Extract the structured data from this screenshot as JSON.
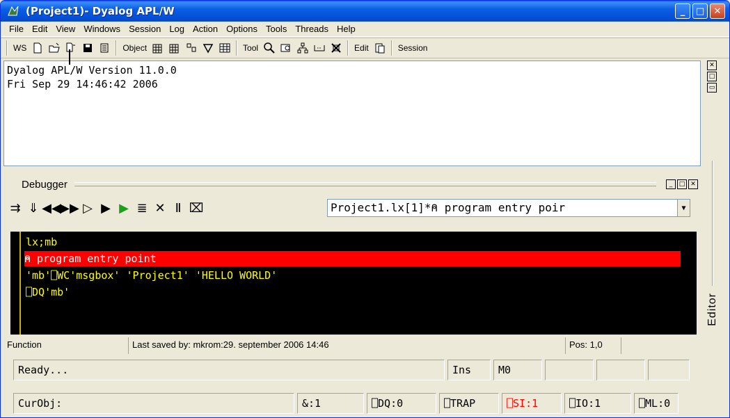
{
  "window": {
    "title": "(Project1)- Dyalog APL/W"
  },
  "menu": [
    "File",
    "Edit",
    "View",
    "Windows",
    "Session",
    "Log",
    "Action",
    "Options",
    "Tools",
    "Threads",
    "Help"
  ],
  "toolbar": {
    "ws_label": "WS",
    "object_label": "Object",
    "tool_label": "Tool",
    "edit_label": "Edit",
    "session_label": "Session"
  },
  "session": {
    "lines": [
      "Dyalog APL/W Version 11.0.0",
      "Fri Sep 29 14:46:42 2006"
    ]
  },
  "debugger": {
    "title": "Debugger",
    "selected_function": "Project1.lx[1]*⍝ program entry poir",
    "code": [
      "lx;mb",
      "⍝ program entry point",
      "'mb'⎕WC'msgbox' 'Project1' 'HELLO WORLD'",
      "⎕DQ'mb'"
    ],
    "status": {
      "type": "Function",
      "saved": "Last saved by: mkrom:29. september 2006 14:46",
      "pos": "Pos: 1,0"
    }
  },
  "editor_tab": "Editor",
  "status1": {
    "message": "Ready...",
    "ins": "Ins",
    "mode": "M0"
  },
  "status2": {
    "curobj": "CurObj:",
    "amp": "&:1",
    "dq": "⎕DQ:0",
    "trap": "⎕TRAP",
    "si": "⎕SI:1",
    "io": "⎕IO:1",
    "ml": "⎕ML:0"
  },
  "colors": {
    "active_line": "#ff0000",
    "code_fg": "#ffff00",
    "si_color": "#ff0000"
  }
}
